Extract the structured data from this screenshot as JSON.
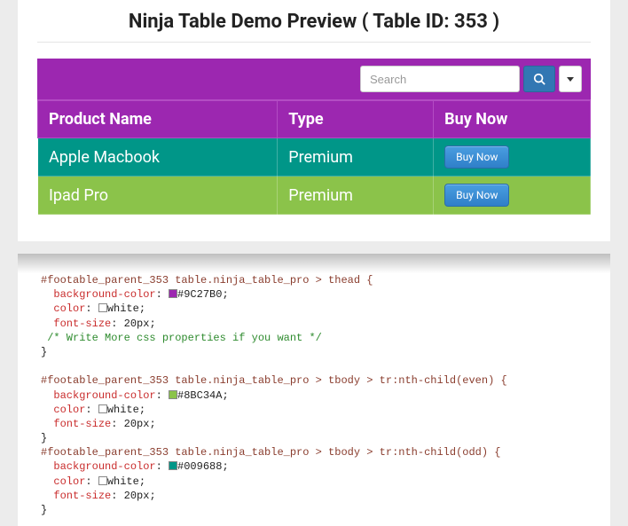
{
  "title": "Ninja Table Demo Preview ( Table ID: 353 )",
  "search": {
    "placeholder": "Search"
  },
  "table": {
    "headers": [
      "Product Name",
      "Type",
      "Buy Now"
    ],
    "rows": [
      {
        "name": "Apple Macbook",
        "type": "Premium",
        "buy": "Buy Now"
      },
      {
        "name": "Ipad Pro",
        "type": "Premium",
        "buy": "Buy Now"
      }
    ]
  },
  "colors": {
    "head": "#9C27B0",
    "even": "#8BC34A",
    "odd": "#009688"
  },
  "css": {
    "sel_head": "#footable_parent_353 table.ninja_table_pro > thead {",
    "bg_label": "background-color",
    "color_label": "color",
    "fs_label": "font-size",
    "fs_value": "20px",
    "white": "white",
    "comment": "/* Write More css properties if you want */",
    "close": "}",
    "sel_even": "#footable_parent_353 table.ninja_table_pro > tbody > tr:nth-child(even) {",
    "sel_odd": "#footable_parent_353 table.ninja_table_pro > tbody > tr:nth-child(odd) {"
  }
}
